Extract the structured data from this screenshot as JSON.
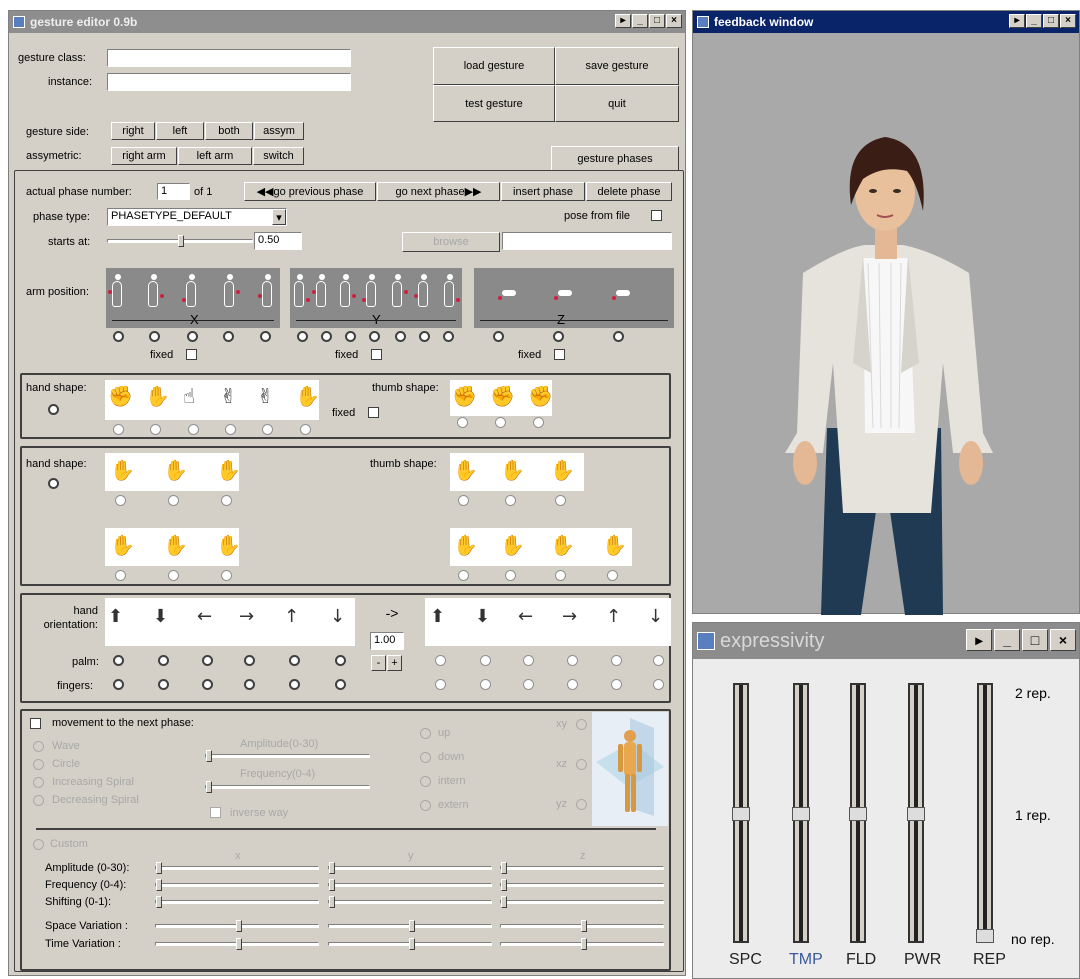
{
  "editor": {
    "title": "gesture editor 0.9b",
    "gesture_class_label": "gesture class:",
    "instance_label": "instance:",
    "gesture_class_value": "",
    "instance_value": "",
    "buttons": {
      "load": "load gesture",
      "save": "save gesture",
      "test": "test gesture",
      "quit": "quit"
    },
    "gesture_side_label": "gesture side:",
    "side_buttons": [
      "right",
      "left",
      "both",
      "assym"
    ],
    "assymetric_label": "assymetric:",
    "assym_buttons": [
      "right arm",
      "left arm",
      "switch"
    ],
    "tab": "gesture phases",
    "phase_number_label": "actual phase number:",
    "phase_number": "1",
    "phase_of": "of 1",
    "prev_phase": "go previous phase",
    "next_phase": "go next phase",
    "insert_phase": "insert phase",
    "delete_phase": "delete phase",
    "phase_type_label": "phase type:",
    "phase_type": "PHASETYPE_DEFAULT",
    "pose_from_file": "pose from file",
    "starts_at_label": "starts at:",
    "starts_at": "0.50",
    "starts_at_fraction": 0.5,
    "browse": "browse",
    "arm_position_label": "arm position:",
    "axis": [
      "X",
      "Y",
      "Z"
    ],
    "fixed": "fixed",
    "hand_shape_label": "hand shape:",
    "thumb_shape_label": "thumb shape:",
    "hand_orientation_label": "hand orientation:",
    "orientation_arrow": "->",
    "orientation_value": "1.00",
    "minus": "-",
    "plus": "+",
    "palm_label": "palm:",
    "fingers_label": "fingers:",
    "movement_label": "movement to the next phase:",
    "movement_types": [
      "Wave",
      "Circle",
      "Increasing Spiral",
      "Decreasing Spiral"
    ],
    "amplitude_small": "Amplitude(0-30)",
    "frequency_small": "Frequency(0-4)",
    "inverse_way": "inverse way",
    "directions": [
      "up",
      "down",
      "intern",
      "extern"
    ],
    "planes": [
      "xy",
      "xz",
      "yz"
    ],
    "custom": "Custom",
    "xyz": [
      "x",
      "y",
      "z"
    ],
    "custom_rows": [
      "Amplitude (0-30):",
      "Frequency (0-4):",
      "Shifting (0-1):",
      "Space Variation :",
      "Time Variation :"
    ]
  },
  "feedback": {
    "title": "feedback window"
  },
  "expressivity": {
    "title": "expressivity",
    "sliders": [
      {
        "label": "SPC",
        "value": 0.5
      },
      {
        "label": "TMP",
        "value": 0.5
      },
      {
        "label": "FLD",
        "value": 0.5
      },
      {
        "label": "PWR",
        "value": 0.5
      },
      {
        "label": "REP",
        "value": 0.0
      }
    ],
    "rep_labels": [
      "2 rep.",
      "1 rep.",
      "no rep."
    ]
  },
  "colors": {
    "titlebar_active": "#0a246a",
    "titlebar_inactive": "#8e8e8e",
    "window_bg": "#d4d0c8",
    "viewport_bg": "#a9a9a9"
  }
}
